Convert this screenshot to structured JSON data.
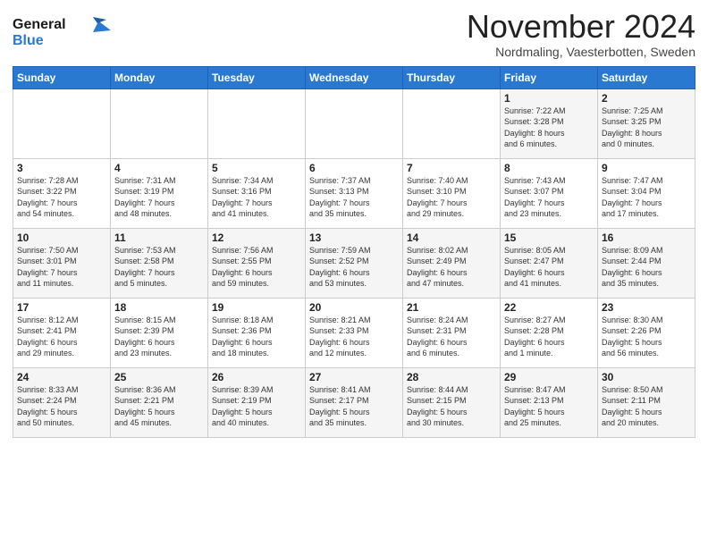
{
  "logo": {
    "line1": "General",
    "line2": "Blue"
  },
  "title": "November 2024",
  "subtitle": "Nordmaling, Vaesterbotten, Sweden",
  "weekdays": [
    "Sunday",
    "Monday",
    "Tuesday",
    "Wednesday",
    "Thursday",
    "Friday",
    "Saturday"
  ],
  "weeks": [
    [
      {
        "day": "",
        "info": ""
      },
      {
        "day": "",
        "info": ""
      },
      {
        "day": "",
        "info": ""
      },
      {
        "day": "",
        "info": ""
      },
      {
        "day": "",
        "info": ""
      },
      {
        "day": "1",
        "info": "Sunrise: 7:22 AM\nSunset: 3:28 PM\nDaylight: 8 hours\nand 6 minutes."
      },
      {
        "day": "2",
        "info": "Sunrise: 7:25 AM\nSunset: 3:25 PM\nDaylight: 8 hours\nand 0 minutes."
      }
    ],
    [
      {
        "day": "3",
        "info": "Sunrise: 7:28 AM\nSunset: 3:22 PM\nDaylight: 7 hours\nand 54 minutes."
      },
      {
        "day": "4",
        "info": "Sunrise: 7:31 AM\nSunset: 3:19 PM\nDaylight: 7 hours\nand 48 minutes."
      },
      {
        "day": "5",
        "info": "Sunrise: 7:34 AM\nSunset: 3:16 PM\nDaylight: 7 hours\nand 41 minutes."
      },
      {
        "day": "6",
        "info": "Sunrise: 7:37 AM\nSunset: 3:13 PM\nDaylight: 7 hours\nand 35 minutes."
      },
      {
        "day": "7",
        "info": "Sunrise: 7:40 AM\nSunset: 3:10 PM\nDaylight: 7 hours\nand 29 minutes."
      },
      {
        "day": "8",
        "info": "Sunrise: 7:43 AM\nSunset: 3:07 PM\nDaylight: 7 hours\nand 23 minutes."
      },
      {
        "day": "9",
        "info": "Sunrise: 7:47 AM\nSunset: 3:04 PM\nDaylight: 7 hours\nand 17 minutes."
      }
    ],
    [
      {
        "day": "10",
        "info": "Sunrise: 7:50 AM\nSunset: 3:01 PM\nDaylight: 7 hours\nand 11 minutes."
      },
      {
        "day": "11",
        "info": "Sunrise: 7:53 AM\nSunset: 2:58 PM\nDaylight: 7 hours\nand 5 minutes."
      },
      {
        "day": "12",
        "info": "Sunrise: 7:56 AM\nSunset: 2:55 PM\nDaylight: 6 hours\nand 59 minutes."
      },
      {
        "day": "13",
        "info": "Sunrise: 7:59 AM\nSunset: 2:52 PM\nDaylight: 6 hours\nand 53 minutes."
      },
      {
        "day": "14",
        "info": "Sunrise: 8:02 AM\nSunset: 2:49 PM\nDaylight: 6 hours\nand 47 minutes."
      },
      {
        "day": "15",
        "info": "Sunrise: 8:05 AM\nSunset: 2:47 PM\nDaylight: 6 hours\nand 41 minutes."
      },
      {
        "day": "16",
        "info": "Sunrise: 8:09 AM\nSunset: 2:44 PM\nDaylight: 6 hours\nand 35 minutes."
      }
    ],
    [
      {
        "day": "17",
        "info": "Sunrise: 8:12 AM\nSunset: 2:41 PM\nDaylight: 6 hours\nand 29 minutes."
      },
      {
        "day": "18",
        "info": "Sunrise: 8:15 AM\nSunset: 2:39 PM\nDaylight: 6 hours\nand 23 minutes."
      },
      {
        "day": "19",
        "info": "Sunrise: 8:18 AM\nSunset: 2:36 PM\nDaylight: 6 hours\nand 18 minutes."
      },
      {
        "day": "20",
        "info": "Sunrise: 8:21 AM\nSunset: 2:33 PM\nDaylight: 6 hours\nand 12 minutes."
      },
      {
        "day": "21",
        "info": "Sunrise: 8:24 AM\nSunset: 2:31 PM\nDaylight: 6 hours\nand 6 minutes."
      },
      {
        "day": "22",
        "info": "Sunrise: 8:27 AM\nSunset: 2:28 PM\nDaylight: 6 hours\nand 1 minute."
      },
      {
        "day": "23",
        "info": "Sunrise: 8:30 AM\nSunset: 2:26 PM\nDaylight: 5 hours\nand 56 minutes."
      }
    ],
    [
      {
        "day": "24",
        "info": "Sunrise: 8:33 AM\nSunset: 2:24 PM\nDaylight: 5 hours\nand 50 minutes."
      },
      {
        "day": "25",
        "info": "Sunrise: 8:36 AM\nSunset: 2:21 PM\nDaylight: 5 hours\nand 45 minutes."
      },
      {
        "day": "26",
        "info": "Sunrise: 8:39 AM\nSunset: 2:19 PM\nDaylight: 5 hours\nand 40 minutes."
      },
      {
        "day": "27",
        "info": "Sunrise: 8:41 AM\nSunset: 2:17 PM\nDaylight: 5 hours\nand 35 minutes."
      },
      {
        "day": "28",
        "info": "Sunrise: 8:44 AM\nSunset: 2:15 PM\nDaylight: 5 hours\nand 30 minutes."
      },
      {
        "day": "29",
        "info": "Sunrise: 8:47 AM\nSunset: 2:13 PM\nDaylight: 5 hours\nand 25 minutes."
      },
      {
        "day": "30",
        "info": "Sunrise: 8:50 AM\nSunset: 2:11 PM\nDaylight: 5 hours\nand 20 minutes."
      }
    ]
  ]
}
